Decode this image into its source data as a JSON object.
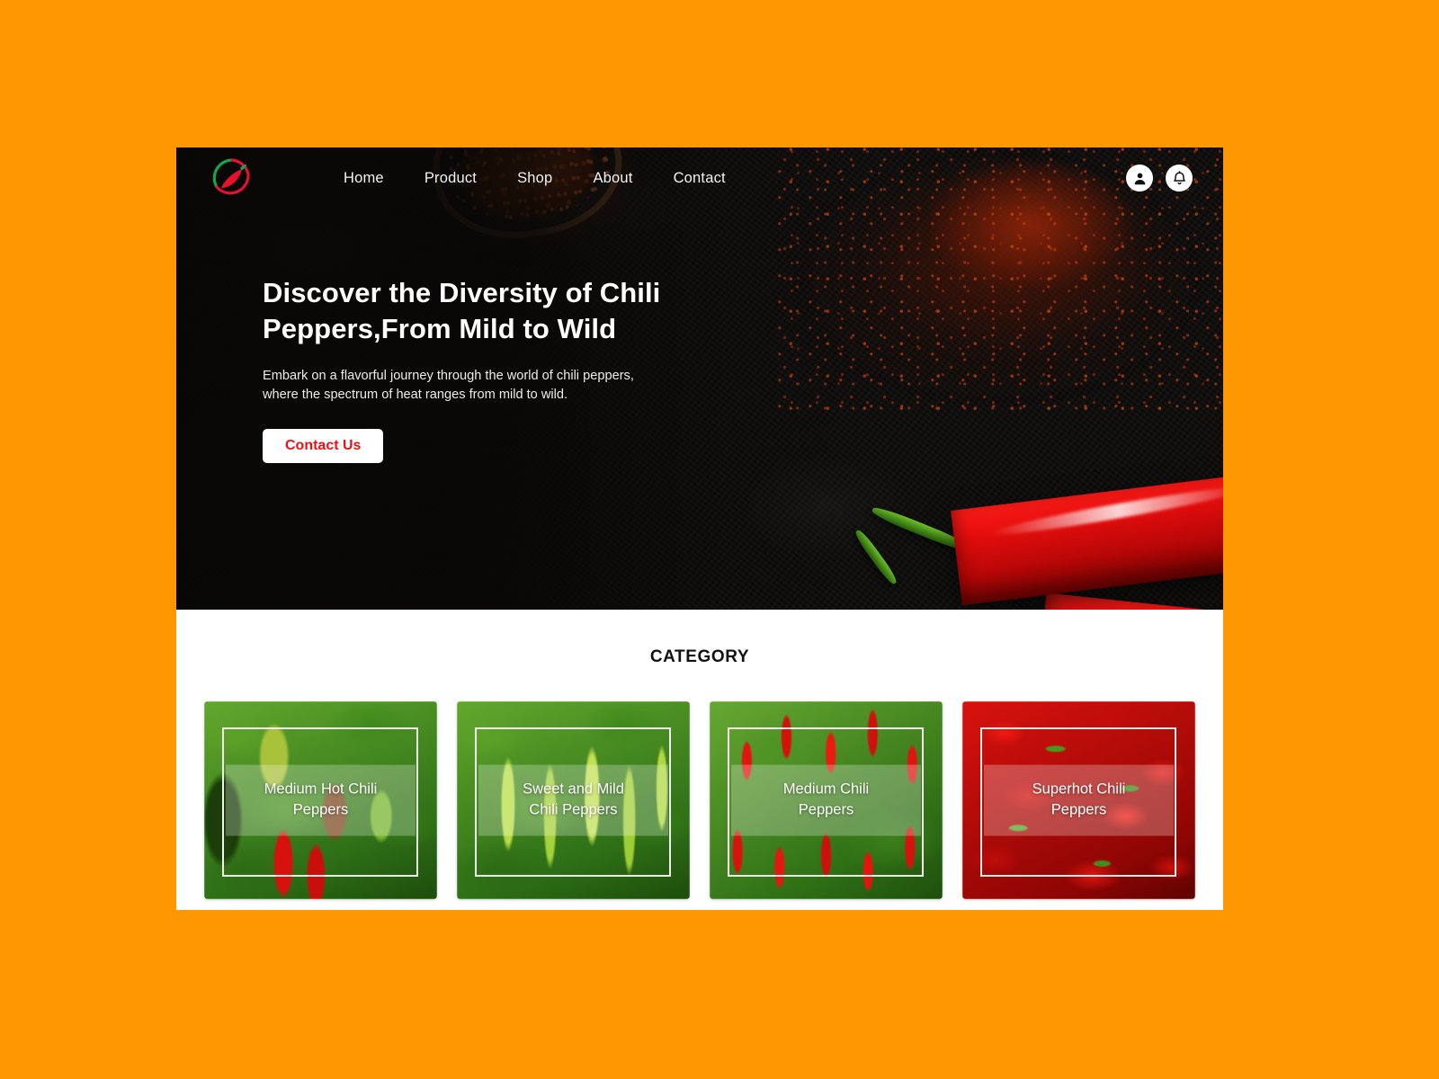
{
  "theme": {
    "page_background": "#FF9800",
    "hero_background": "#0c0b0a",
    "accent_red": "#EF1111",
    "surface_white": "#FFFFFF"
  },
  "navbar": {
    "logo_name": "chili-pepper-logo",
    "links": [
      {
        "label": "Home"
      },
      {
        "label": "Product"
      },
      {
        "label": "Shop"
      },
      {
        "label": "About"
      },
      {
        "label": "Contact"
      }
    ],
    "actions": [
      {
        "icon": "user-account-icon"
      },
      {
        "icon": "notification-bell-icon"
      }
    ]
  },
  "hero": {
    "title": "Discover the Diversity of Chili\nPeppers,From Mild to Wild",
    "subtitle": "Embark on a flavorful journey through the world of chili peppers,\nwhere the spectrum of heat ranges from mild to wild.",
    "cta_label": "Contact Us"
  },
  "category": {
    "title": "CATEGORY",
    "cards": [
      {
        "label": "Medium Hot Chili\nPeppers",
        "image": "jalapeno-plant-photo"
      },
      {
        "label": "Sweet and Mild\nChili Peppers",
        "image": "green-chili-plant-photo"
      },
      {
        "label": "Medium Chili\nPeppers",
        "image": "red-upright-chili-plant-photo"
      },
      {
        "label": "Superhot Chili\nPeppers",
        "image": "pile-of-red-chilies-photo"
      }
    ]
  }
}
